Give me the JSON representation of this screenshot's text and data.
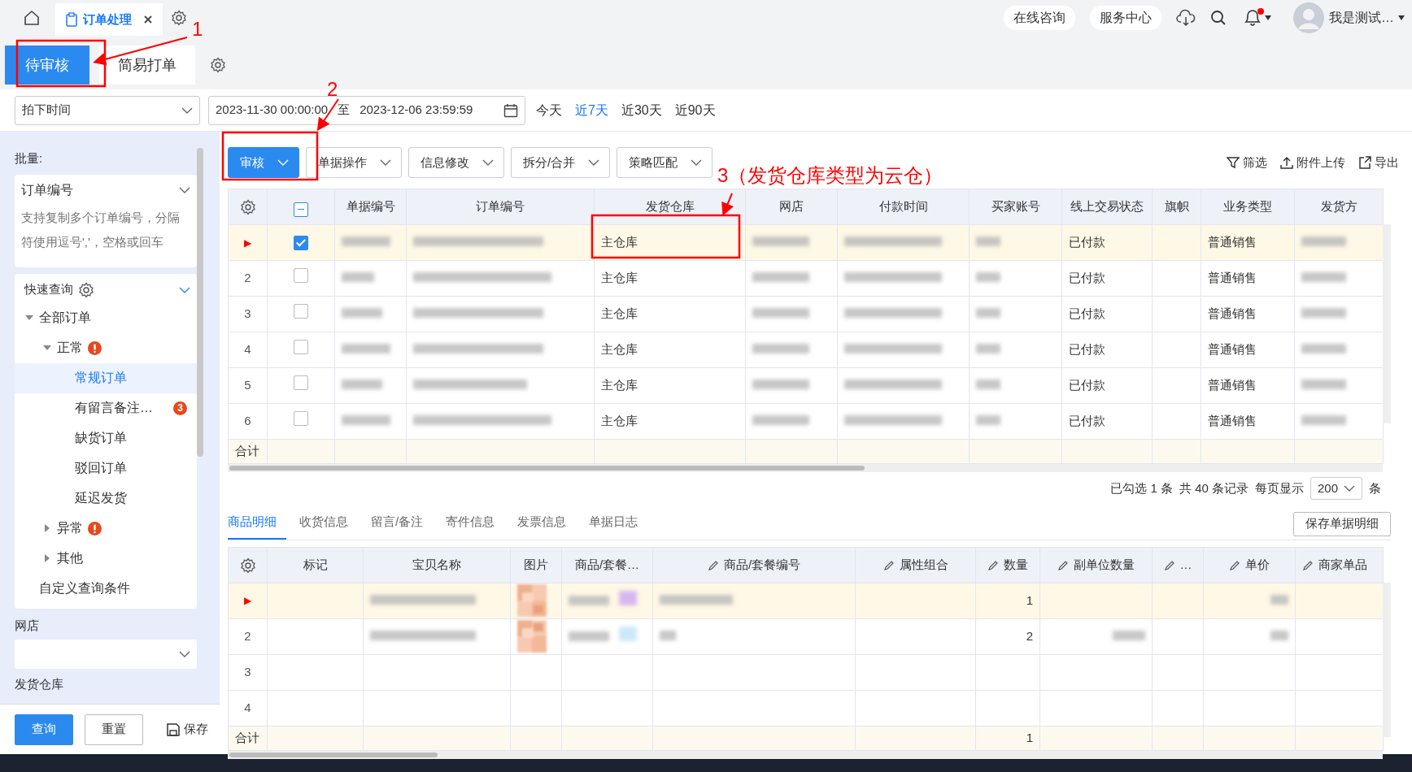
{
  "topbar": {
    "tabs": [
      {
        "label": "订单处理",
        "selected": true
      }
    ],
    "links": [
      "在线咨询",
      "服务中心"
    ],
    "has_unread": true,
    "user": "我是测试…"
  },
  "subtabs": [
    {
      "label": "待审核",
      "selected": true
    },
    {
      "label": "简易打单",
      "selected": false
    }
  ],
  "filter": {
    "date_type": "拍下时间",
    "start": "2023-11-30 00:00:00",
    "separator": "至",
    "end": "2023-12-06 23:59:59",
    "ranges": [
      {
        "label": "今天",
        "selected": false
      },
      {
        "label": "近7天",
        "selected": true
      },
      {
        "label": "近30天",
        "selected": false
      },
      {
        "label": "近90天",
        "selected": false
      }
    ]
  },
  "sidebar": {
    "batch_label": "批量:",
    "batch_select": "订单编号",
    "batch_placeholder": "支持复制多个订单编号，分隔符使用逗号','，空格或回车",
    "quick_query": "快速查询",
    "tree": [
      {
        "label": "全部订单",
        "expanded": true,
        "children": [
          {
            "label": "正常",
            "expanded": true,
            "alert": true,
            "children": [
              {
                "label": "常规订单",
                "selected": true
              },
              {
                "label": "有留言备注…",
                "selected": false,
                "badge": "3"
              },
              {
                "label": "缺货订单",
                "selected": false
              },
              {
                "label": "驳回订单",
                "selected": false
              },
              {
                "label": "延迟发货",
                "selected": false
              }
            ]
          },
          {
            "label": "异常",
            "expanded": false,
            "alert": true
          },
          {
            "label": "其他",
            "expanded": false,
            "alert": false
          }
        ]
      },
      {
        "label": "自定义查询条件"
      }
    ],
    "shop_label": "网店",
    "warehouse_label": "发货仓库",
    "buttons": [
      {
        "label": "查询",
        "kind": "primary"
      },
      {
        "label": "重置",
        "kind": "outline"
      },
      {
        "label": "保存",
        "kind": "save"
      }
    ]
  },
  "toolbar": {
    "menus": [
      {
        "label": "审核",
        "kind": "primary"
      },
      {
        "label": "单据操作",
        "kind": "outline"
      },
      {
        "label": "信息修改",
        "kind": "outline"
      },
      {
        "label": "拆分/合并",
        "kind": "outline"
      },
      {
        "label": "策略匹配",
        "kind": "outline"
      }
    ],
    "actions": [
      {
        "label": "筛选",
        "kind": "filter"
      },
      {
        "label": "附件上传",
        "kind": "upload"
      },
      {
        "label": "导出",
        "kind": "export"
      }
    ]
  },
  "orders": {
    "select_all_partial": true,
    "columns": [
      "单据编号",
      "订单编号",
      "发货仓库",
      "网店",
      "付款时间",
      "买家账号",
      "线上交易状态",
      "旗帜",
      "业务类型",
      "发货方"
    ],
    "rows": [
      {
        "row_header": "▶",
        "current": true,
        "checked": true,
        "warehouse": "主仓库",
        "trade_status": "已付款",
        "business_type": "普通销售"
      },
      {
        "row_header": "2",
        "current": false,
        "checked": false,
        "warehouse": "主仓库",
        "trade_status": "已付款",
        "business_type": "普通销售"
      },
      {
        "row_header": "3",
        "current": false,
        "checked": false,
        "warehouse": "主仓库",
        "trade_status": "已付款",
        "business_type": "普通销售"
      },
      {
        "row_header": "4",
        "current": false,
        "checked": false,
        "warehouse": "主仓库",
        "trade_status": "已付款",
        "business_type": "普通销售"
      },
      {
        "row_header": "5",
        "current": false,
        "checked": false,
        "warehouse": "主仓库",
        "trade_status": "已付款",
        "business_type": "普通销售"
      },
      {
        "row_header": "6",
        "current": false,
        "checked": false,
        "warehouse": "主仓库",
        "trade_status": "已付款",
        "business_type": "普通销售"
      }
    ],
    "total_label": "合计"
  },
  "pagination": {
    "selected": "已勾选 1 条",
    "total": "共 40 条记录",
    "per_page_label": "每页显示",
    "per_page": "200",
    "unit": "条"
  },
  "detail_tabs": [
    {
      "label": "商品明细",
      "selected": true
    },
    {
      "label": "收货信息",
      "selected": false
    },
    {
      "label": "留言/备注",
      "selected": false
    },
    {
      "label": "寄件信息",
      "selected": false
    },
    {
      "label": "发票信息",
      "selected": false
    },
    {
      "label": "单据日志",
      "selected": false
    }
  ],
  "save_detail": "保存单据明细",
  "items": {
    "columns": [
      {
        "label": "标记",
        "editable": false
      },
      {
        "label": "宝贝名称",
        "editable": false
      },
      {
        "label": "图片",
        "editable": false
      },
      {
        "label": "商品/套餐…",
        "editable": false
      },
      {
        "label": "商品/套餐编号",
        "editable": true
      },
      {
        "label": "属性组合",
        "editable": true
      },
      {
        "label": "数量",
        "editable": true
      },
      {
        "label": "副单位数量",
        "editable": true
      },
      {
        "label": "…",
        "editable": true
      },
      {
        "label": "单价",
        "editable": true
      },
      {
        "label": "商家单品",
        "editable": true
      }
    ],
    "rows": [
      {
        "row_header": "▶",
        "current": true,
        "quantity": "1",
        "has_goods": true
      },
      {
        "row_header": "2",
        "current": false,
        "quantity": "2",
        "has_goods": true
      },
      {
        "row_header": "3",
        "current": false,
        "has_goods": false
      },
      {
        "row_header": "4",
        "current": false,
        "has_goods": false
      }
    ],
    "total_label": "合计",
    "total_quantity": "1"
  },
  "annotations": [
    "1",
    "2",
    "3（发货仓库类型为云仓）"
  ]
}
